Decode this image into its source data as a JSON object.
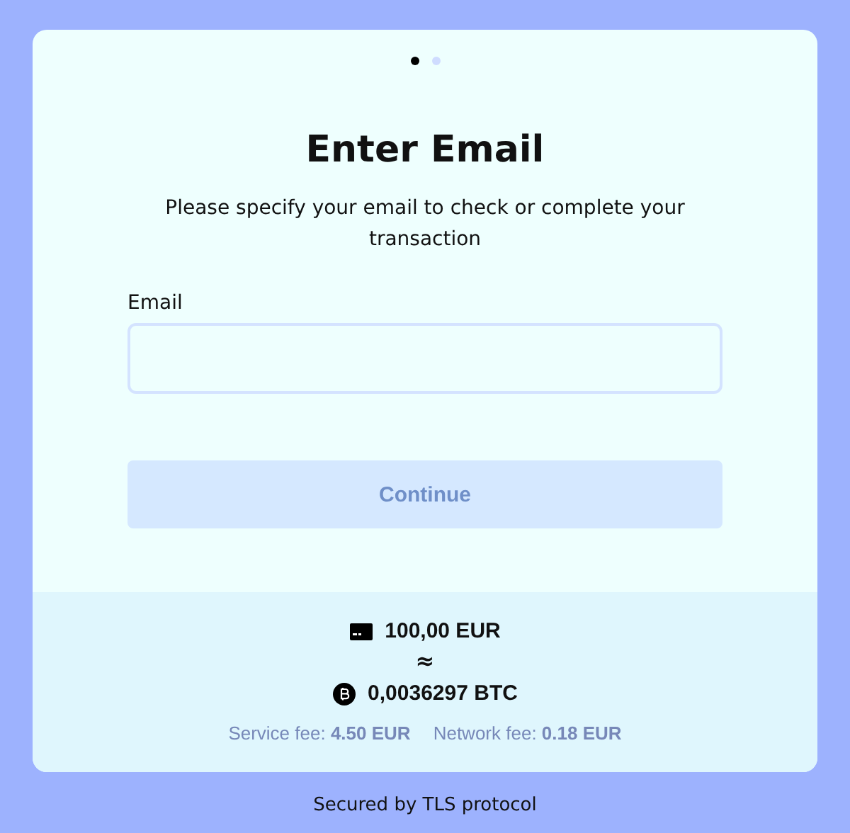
{
  "steps": [
    {
      "selected": true
    },
    {
      "selected": false
    }
  ],
  "title": "Enter Email",
  "subtitle": "Please specify your email to check or complete your transaction",
  "email_field": {
    "label": "Email"
  },
  "continue_button": {
    "label": "Continue",
    "disabled": true
  },
  "summary": {
    "fiat_amount": "100,00 EUR",
    "approx": "≈",
    "crypto_amount": "0,0036297 BTC",
    "fees": [
      "Service fee: **4.50 EUR**",
      "Network fee: **0.18 EUR**"
    ]
  },
  "footer": "Secured by TLS protocol"
}
